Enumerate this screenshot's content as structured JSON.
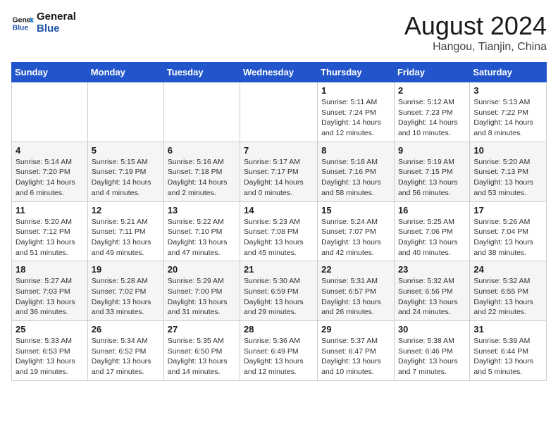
{
  "logo": {
    "line1": "General",
    "line2": "Blue"
  },
  "title": "August 2024",
  "location": "Hangou, Tianjin, China",
  "weekdays": [
    "Sunday",
    "Monday",
    "Tuesday",
    "Wednesday",
    "Thursday",
    "Friday",
    "Saturday"
  ],
  "weeks": [
    [
      {
        "day": "",
        "info": ""
      },
      {
        "day": "",
        "info": ""
      },
      {
        "day": "",
        "info": ""
      },
      {
        "day": "",
        "info": ""
      },
      {
        "day": "1",
        "info": "Sunrise: 5:11 AM\nSunset: 7:24 PM\nDaylight: 14 hours\nand 12 minutes."
      },
      {
        "day": "2",
        "info": "Sunrise: 5:12 AM\nSunset: 7:23 PM\nDaylight: 14 hours\nand 10 minutes."
      },
      {
        "day": "3",
        "info": "Sunrise: 5:13 AM\nSunset: 7:22 PM\nDaylight: 14 hours\nand 8 minutes."
      }
    ],
    [
      {
        "day": "4",
        "info": "Sunrise: 5:14 AM\nSunset: 7:20 PM\nDaylight: 14 hours\nand 6 minutes."
      },
      {
        "day": "5",
        "info": "Sunrise: 5:15 AM\nSunset: 7:19 PM\nDaylight: 14 hours\nand 4 minutes."
      },
      {
        "day": "6",
        "info": "Sunrise: 5:16 AM\nSunset: 7:18 PM\nDaylight: 14 hours\nand 2 minutes."
      },
      {
        "day": "7",
        "info": "Sunrise: 5:17 AM\nSunset: 7:17 PM\nDaylight: 14 hours\nand 0 minutes."
      },
      {
        "day": "8",
        "info": "Sunrise: 5:18 AM\nSunset: 7:16 PM\nDaylight: 13 hours\nand 58 minutes."
      },
      {
        "day": "9",
        "info": "Sunrise: 5:19 AM\nSunset: 7:15 PM\nDaylight: 13 hours\nand 56 minutes."
      },
      {
        "day": "10",
        "info": "Sunrise: 5:20 AM\nSunset: 7:13 PM\nDaylight: 13 hours\nand 53 minutes."
      }
    ],
    [
      {
        "day": "11",
        "info": "Sunrise: 5:20 AM\nSunset: 7:12 PM\nDaylight: 13 hours\nand 51 minutes."
      },
      {
        "day": "12",
        "info": "Sunrise: 5:21 AM\nSunset: 7:11 PM\nDaylight: 13 hours\nand 49 minutes."
      },
      {
        "day": "13",
        "info": "Sunrise: 5:22 AM\nSunset: 7:10 PM\nDaylight: 13 hours\nand 47 minutes."
      },
      {
        "day": "14",
        "info": "Sunrise: 5:23 AM\nSunset: 7:08 PM\nDaylight: 13 hours\nand 45 minutes."
      },
      {
        "day": "15",
        "info": "Sunrise: 5:24 AM\nSunset: 7:07 PM\nDaylight: 13 hours\nand 42 minutes."
      },
      {
        "day": "16",
        "info": "Sunrise: 5:25 AM\nSunset: 7:06 PM\nDaylight: 13 hours\nand 40 minutes."
      },
      {
        "day": "17",
        "info": "Sunrise: 5:26 AM\nSunset: 7:04 PM\nDaylight: 13 hours\nand 38 minutes."
      }
    ],
    [
      {
        "day": "18",
        "info": "Sunrise: 5:27 AM\nSunset: 7:03 PM\nDaylight: 13 hours\nand 36 minutes."
      },
      {
        "day": "19",
        "info": "Sunrise: 5:28 AM\nSunset: 7:02 PM\nDaylight: 13 hours\nand 33 minutes."
      },
      {
        "day": "20",
        "info": "Sunrise: 5:29 AM\nSunset: 7:00 PM\nDaylight: 13 hours\nand 31 minutes."
      },
      {
        "day": "21",
        "info": "Sunrise: 5:30 AM\nSunset: 6:59 PM\nDaylight: 13 hours\nand 29 minutes."
      },
      {
        "day": "22",
        "info": "Sunrise: 5:31 AM\nSunset: 6:57 PM\nDaylight: 13 hours\nand 26 minutes."
      },
      {
        "day": "23",
        "info": "Sunrise: 5:32 AM\nSunset: 6:56 PM\nDaylight: 13 hours\nand 24 minutes."
      },
      {
        "day": "24",
        "info": "Sunrise: 5:32 AM\nSunset: 6:55 PM\nDaylight: 13 hours\nand 22 minutes."
      }
    ],
    [
      {
        "day": "25",
        "info": "Sunrise: 5:33 AM\nSunset: 6:53 PM\nDaylight: 13 hours\nand 19 minutes."
      },
      {
        "day": "26",
        "info": "Sunrise: 5:34 AM\nSunset: 6:52 PM\nDaylight: 13 hours\nand 17 minutes."
      },
      {
        "day": "27",
        "info": "Sunrise: 5:35 AM\nSunset: 6:50 PM\nDaylight: 13 hours\nand 14 minutes."
      },
      {
        "day": "28",
        "info": "Sunrise: 5:36 AM\nSunset: 6:49 PM\nDaylight: 13 hours\nand 12 minutes."
      },
      {
        "day": "29",
        "info": "Sunrise: 5:37 AM\nSunset: 6:47 PM\nDaylight: 13 hours\nand 10 minutes."
      },
      {
        "day": "30",
        "info": "Sunrise: 5:38 AM\nSunset: 6:46 PM\nDaylight: 13 hours\nand 7 minutes."
      },
      {
        "day": "31",
        "info": "Sunrise: 5:39 AM\nSunset: 6:44 PM\nDaylight: 13 hours\nand 5 minutes."
      }
    ]
  ]
}
